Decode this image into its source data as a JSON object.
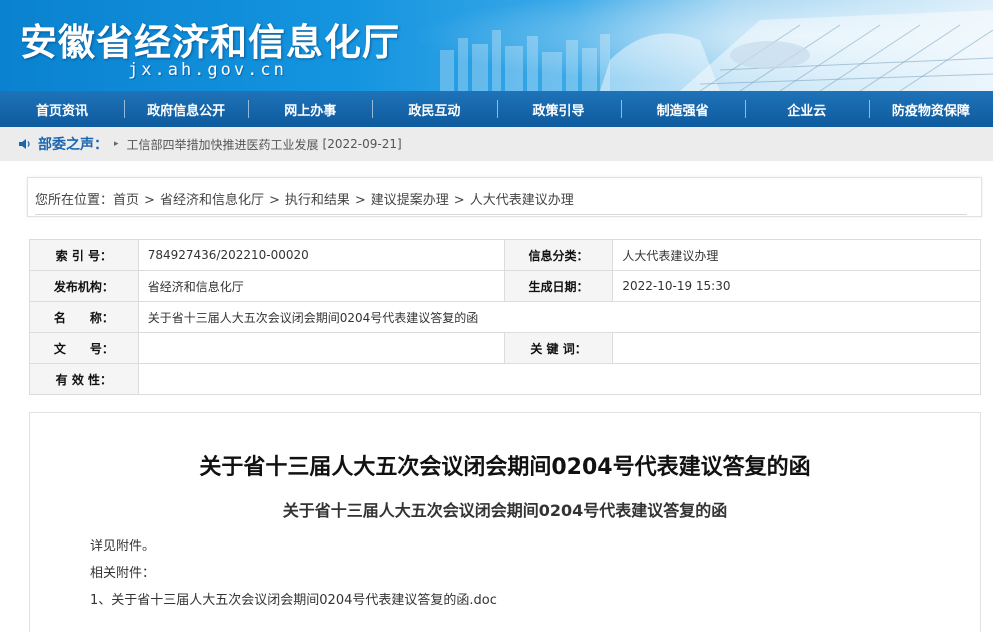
{
  "header": {
    "title": "安徽省经济和信息化厅",
    "domain": "jx.ah.gov.cn",
    "colors": {
      "banner_blue": "#1494df",
      "nav_blue": "#1565a9"
    }
  },
  "nav": {
    "items": [
      "首页资讯",
      "政府信息公开",
      "网上办事",
      "政民互动",
      "政策引导",
      "制造强省",
      "企业云",
      "防疫物资保障"
    ]
  },
  "ticker": {
    "icon": "speaker-icon",
    "label": "部委之声：",
    "text": "工信部四举措加快推进医药工业发展",
    "date": "[2022-09-21]"
  },
  "breadcrumb": {
    "prefix": "您所在位置：",
    "items": [
      "首页",
      "省经济和信息化厅",
      "执行和结果",
      "建议提案办理",
      "人大代表建议办理"
    ],
    "separator": ">"
  },
  "info": {
    "index_label": "索 引 号：",
    "index_value": "784927436/202210-00020",
    "category_label": "信息分类：",
    "category_value": "人大代表建议办理",
    "publisher_label": "发布机构：",
    "publisher_value": "省经济和信息化厅",
    "date_label": "生成日期：",
    "date_value": "2022-10-19 15:30",
    "name_label": "名　　称：",
    "name_value": "关于省十三届人大五次会议闭会期间0204号代表建议答复的函",
    "docno_label": "文　　号：",
    "docno_value": "",
    "keywords_label": "关 键 词：",
    "keywords_value": "",
    "validity_label": "有 效 性：",
    "validity_value": ""
  },
  "article": {
    "title": "关于省十三届人大五次会议闭会期间0204号代表建议答复的函",
    "subtitle": "关于省十三届人大五次会议闭会期间0204号代表建议答复的函",
    "body": "详见附件。",
    "attachments_label": "相关附件：",
    "attachment": "1、关于省十三届人大五次会议闭会期间0204号代表建议答复的函.doc"
  }
}
